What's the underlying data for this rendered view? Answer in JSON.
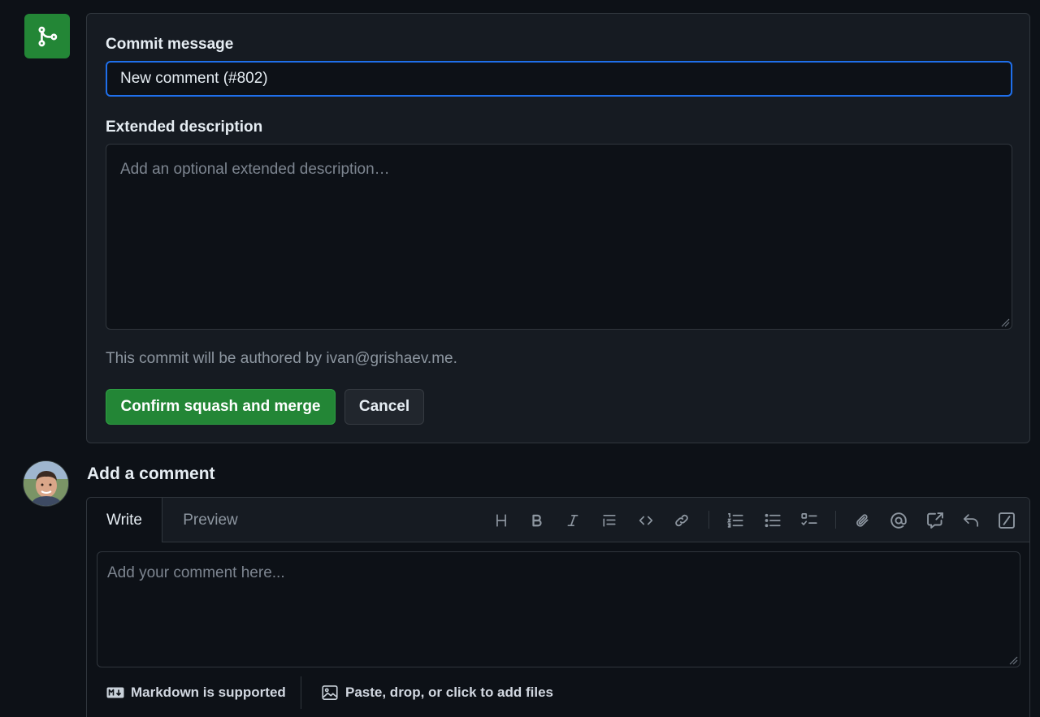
{
  "merge": {
    "icon": "git-merge-icon",
    "commit_message_label": "Commit message",
    "commit_message_value": "New comment (#802)",
    "extended_description_label": "Extended description",
    "extended_description_placeholder": "Add an optional extended description…",
    "author_note": "This commit will be authored by ivan@grishaev.me.",
    "confirm_label": "Confirm squash and merge",
    "cancel_label": "Cancel",
    "accent_color": "#238636",
    "focus_color": "#1f6feb"
  },
  "comment": {
    "heading": "Add a comment",
    "tabs": [
      {
        "label": "Write",
        "active": true
      },
      {
        "label": "Preview",
        "active": false
      }
    ],
    "toolbar": [
      {
        "name": "heading-icon"
      },
      {
        "name": "bold-icon"
      },
      {
        "name": "italic-icon"
      },
      {
        "name": "quote-icon"
      },
      {
        "name": "code-icon"
      },
      {
        "name": "link-icon"
      },
      {
        "name": "numbered-list-icon"
      },
      {
        "name": "unordered-list-icon"
      },
      {
        "name": "task-list-icon"
      },
      {
        "name": "attach-icon"
      },
      {
        "name": "mention-icon"
      },
      {
        "name": "cross-reference-icon"
      },
      {
        "name": "reply-icon"
      },
      {
        "name": "slash-commands-icon"
      }
    ],
    "placeholder": "Add your comment here...",
    "markdown_note": "Markdown is supported",
    "files_note": "Paste, drop, or click to add files"
  }
}
